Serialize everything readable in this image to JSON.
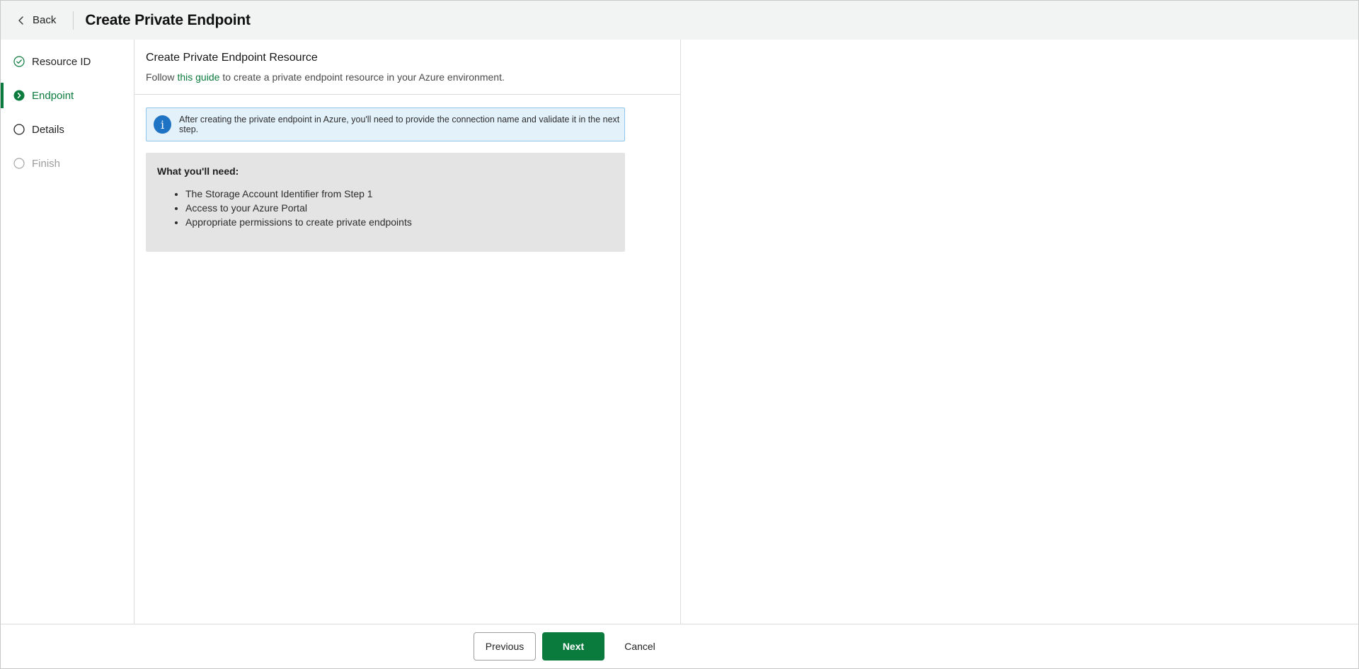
{
  "header": {
    "back_label": "Back",
    "title": "Create Private Endpoint"
  },
  "steps": [
    {
      "label": "Resource ID",
      "state": "completed",
      "icon": "check-circle-icon"
    },
    {
      "label": "Endpoint",
      "state": "active",
      "icon": "chevron-circle-icon"
    },
    {
      "label": "Details",
      "state": "pending",
      "icon": "empty-circle-icon"
    },
    {
      "label": "Finish",
      "state": "disabled",
      "icon": "empty-circle-icon"
    }
  ],
  "main": {
    "title": "Create Private Endpoint Resource",
    "subtitle_prefix": "Follow",
    "subtitle_link": "this guide",
    "subtitle_suffix": "to create a private endpoint resource in your Azure environment.",
    "info": {
      "icon": "info-icon",
      "text": "After creating the private endpoint in Azure, you'll need to provide the connection name and validate it in the next step."
    },
    "needs": {
      "title": "What you'll need:",
      "items": [
        "The Storage Account Identifier from Step 1",
        "Access to your Azure Portal",
        "Appropriate permissions to create private endpoints"
      ]
    }
  },
  "footer": {
    "previous_label": "Previous",
    "next_label": "Next",
    "cancel_label": "Cancel"
  },
  "colors": {
    "accent": "#0b7a3d",
    "info_background": "#e3f1fb",
    "info_border": "#8fc6ea",
    "info_icon": "#1f73c4",
    "header_background": "#f2f3f3",
    "needs_background": "#e4e4e4"
  }
}
